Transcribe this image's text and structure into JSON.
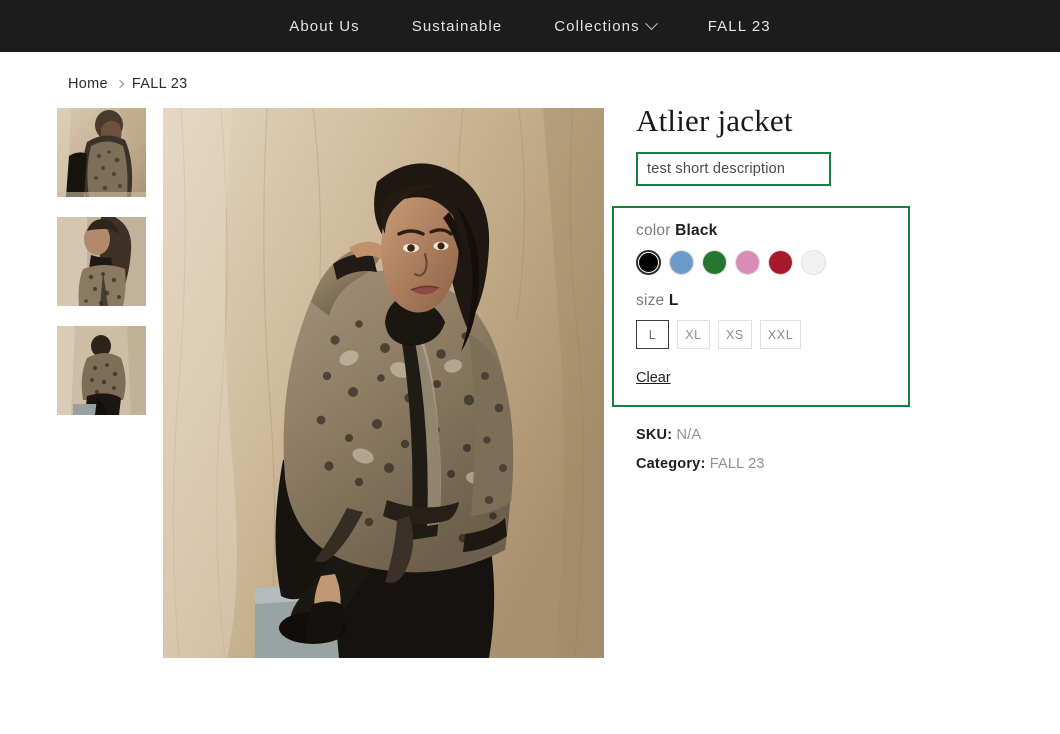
{
  "nav": {
    "items": [
      {
        "label": "About Us",
        "has_dropdown": false
      },
      {
        "label": "Sustainable",
        "has_dropdown": false
      },
      {
        "label": "Collections",
        "has_dropdown": true,
        "icon": "chevron-down-icon"
      },
      {
        "label": "FALL 23",
        "has_dropdown": false
      }
    ],
    "background": "#1c1c1c",
    "text_color": "#e6e4e1"
  },
  "breadcrumb": {
    "home": "Home",
    "separator": "chevron-right-icon",
    "current": "FALL 23"
  },
  "gallery": {
    "thumbnails": [
      {
        "alt": "model leaning wearing patterned jacket"
      },
      {
        "alt": "side profile of model in jacket"
      },
      {
        "alt": "model crouching on block in jacket"
      }
    ],
    "main_image": {
      "alt": "model seated against beige draped backdrop wearing Atlier jacket"
    }
  },
  "product": {
    "title": "Atlier jacket",
    "short_description": "test short description",
    "highlight_color": "#17803d"
  },
  "variations": {
    "color": {
      "label": "color",
      "selected": "Black",
      "options": [
        {
          "name": "Black",
          "hex": "#000000",
          "selected": true
        },
        {
          "name": "Blue",
          "hex": "#6b9bc9",
          "selected": false
        },
        {
          "name": "Green",
          "hex": "#25772f",
          "selected": false
        },
        {
          "name": "Pink",
          "hex": "#d98cb5",
          "selected": false
        },
        {
          "name": "Red",
          "hex": "#a5192a",
          "selected": false
        },
        {
          "name": "White",
          "hex": "#f1f1f1",
          "selected": false
        }
      ]
    },
    "size": {
      "label": "size",
      "selected": "L",
      "options": [
        {
          "name": "L",
          "selected": true
        },
        {
          "name": "XL",
          "selected": false
        },
        {
          "name": "XS",
          "selected": false
        },
        {
          "name": "XXL",
          "selected": false
        }
      ]
    },
    "clear_label": "Clear"
  },
  "meta": {
    "sku_key": "SKU:",
    "sku_value": "N/A",
    "category_key": "Category:",
    "category_value": "FALL 23"
  }
}
